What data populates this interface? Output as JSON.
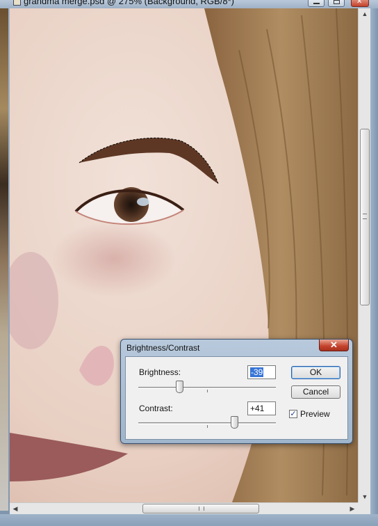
{
  "window": {
    "title": "grandma merge.psd @ 275% (Background, RGB/8*)",
    "title_bar_buttons": [
      "minimize",
      "maximize",
      "close"
    ]
  },
  "icons": {
    "document": "photoshop-document-icon",
    "minimize": "minimize-icon",
    "maximize": "maximize-icon",
    "close": "close-icon",
    "scroll_up": "arrow-up-icon",
    "scroll_down": "arrow-down-icon",
    "scroll_left": "arrow-left-icon",
    "scroll_right": "arrow-right-icon"
  },
  "glyphs": {
    "close": "✕",
    "up": "▲",
    "down": "▼",
    "left": "◀",
    "right": "▶",
    "check": "✓"
  },
  "dialog": {
    "title": "Brightness/Contrast",
    "brightness": {
      "label": "Brightness:",
      "value": "-39",
      "slider_fraction": 0.3
    },
    "contrast": {
      "label": "Contrast:",
      "value": "+41",
      "slider_fraction": 0.7
    },
    "ok_label": "OK",
    "cancel_label": "Cancel",
    "preview_label": "Preview",
    "preview_checked": true
  },
  "scroll": {
    "vertical_position_fraction": 0.37,
    "horizontal_position_fraction": 0.58
  },
  "colors": {
    "skin": "#e9d3c6",
    "hair": "#9a7447",
    "dialog_frame": "#aebfd3",
    "selection_highlight": "#3875d7",
    "close_red": "#c4412b"
  }
}
